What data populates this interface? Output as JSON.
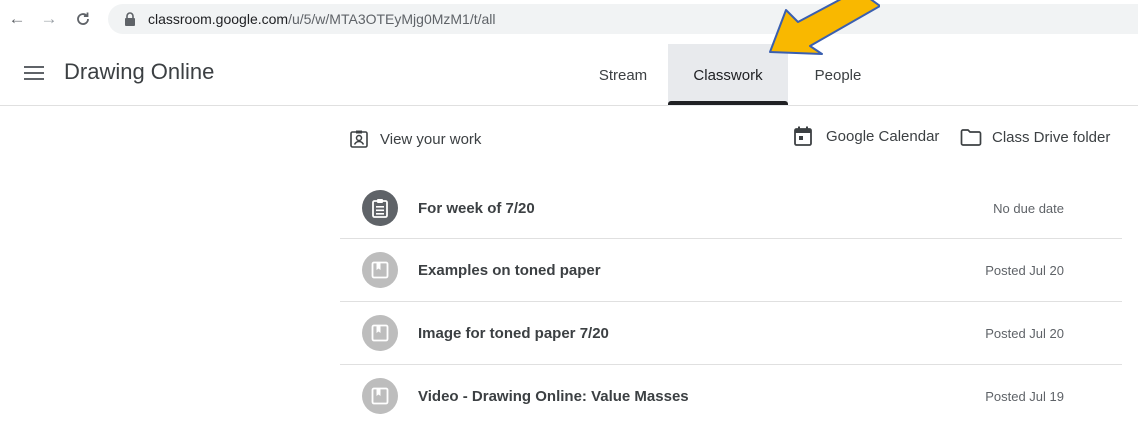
{
  "browser": {
    "url_host": "classroom.google.com",
    "url_path": "/u/5/w/MTA3OTEyMjg0MzM1/t/all",
    "back_icon": "arrow-left-icon",
    "forward_icon": "arrow-right-icon",
    "reload_icon": "reload-icon",
    "lock_icon": "lock-icon"
  },
  "header": {
    "menu_icon": "hamburger-menu-icon",
    "class_title": "Drawing Online",
    "tabs": [
      {
        "label": "Stream",
        "selected": false
      },
      {
        "label": "Classwork",
        "selected": true
      },
      {
        "label": "People",
        "selected": false
      }
    ]
  },
  "annotation": {
    "arrow_color": "#f9b800",
    "arrow_outline": "#3a5fb0"
  },
  "toolbar": {
    "view_work_label": "View your work",
    "calendar_label": "Google Calendar",
    "drive_label": "Class Drive folder"
  },
  "items": [
    {
      "title": "For week of 7/20",
      "meta": "No due date",
      "icon": "assignment-icon",
      "icon_style": "dark"
    },
    {
      "title": "Examples on toned paper",
      "meta": "Posted Jul 20",
      "icon": "material-icon",
      "icon_style": "light"
    },
    {
      "title": "Image for toned paper 7/20",
      "meta": "Posted Jul 20",
      "icon": "material-icon",
      "icon_style": "light"
    },
    {
      "title": "Video - Drawing Online: Value Masses",
      "meta": "Posted Jul 19",
      "icon": "material-icon",
      "icon_style": "light"
    }
  ],
  "colors": {
    "selected_tab_bg": "#e8eaed",
    "selected_tab_underline": "#202124",
    "dark_icon": "#5f6368",
    "light_icon": "#bdbdbd"
  }
}
